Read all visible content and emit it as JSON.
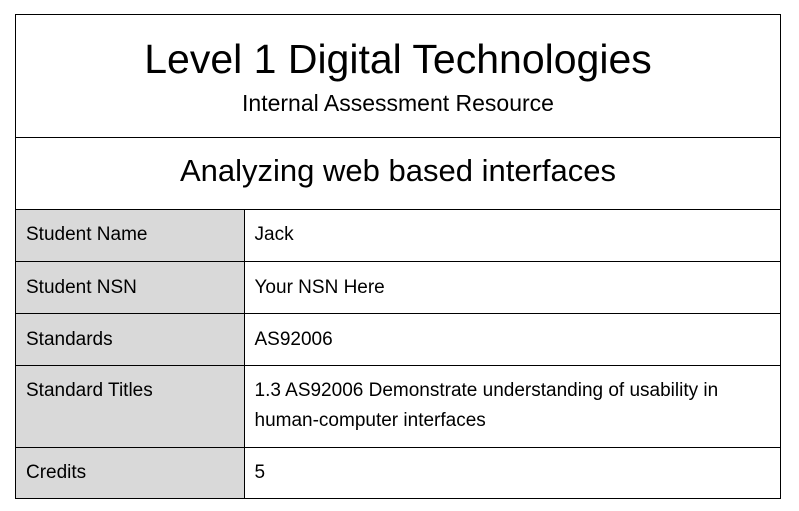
{
  "header": {
    "title": "Level 1 Digital Technologies",
    "subtitle": "Internal Assessment Resource"
  },
  "topic": {
    "title": "Analyzing web based interfaces"
  },
  "info_table": {
    "rows": [
      {
        "label": "Student Name",
        "value": "Jack"
      },
      {
        "label": "Student NSN",
        "value": "Your NSN Here"
      },
      {
        "label": "Standards",
        "value": "AS92006"
      },
      {
        "label": "Standard Titles",
        "value": "1.3 AS92006 Demonstrate understanding of usability in human-computer interfaces"
      },
      {
        "label": "Credits",
        "value": "5"
      }
    ]
  },
  "colors": {
    "label_cell_background": "#d9d9d9",
    "border": "#000000"
  }
}
